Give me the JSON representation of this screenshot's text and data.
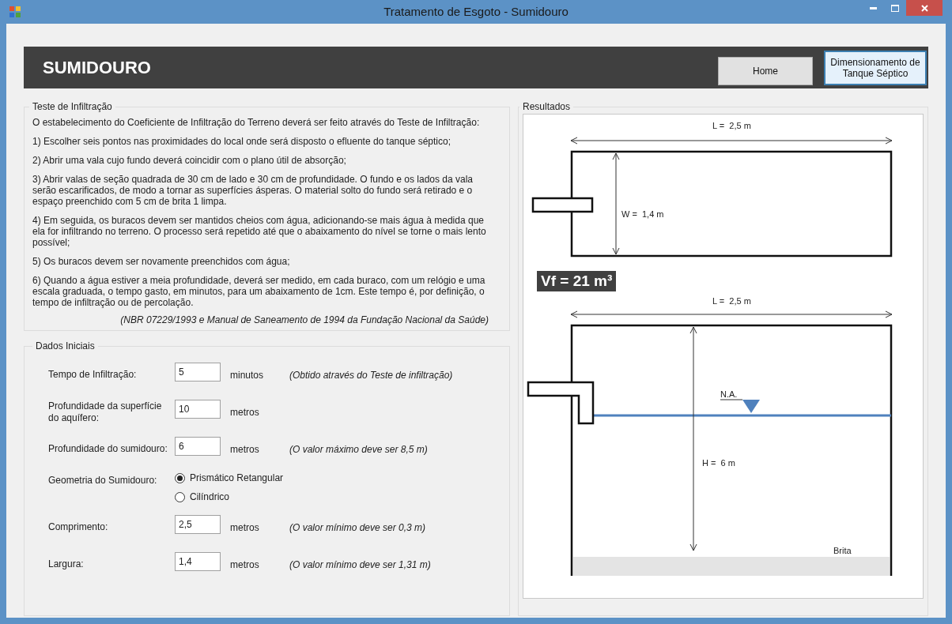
{
  "window": {
    "title": "Tratamento de Esgoto - Sumidouro"
  },
  "header": {
    "title": "SUMIDOURO",
    "buttons": [
      {
        "label": "Home",
        "selected": false
      },
      {
        "label": "Dimensionamento de Tanque Séptico",
        "selected": true
      }
    ]
  },
  "infiltration_test": {
    "title": "Teste de Infiltração",
    "paragraphs": [
      "O estabelecimento do Coeficiente de Infiltração do Terreno deverá ser feito através do Teste de Infiltração:",
      "1) Escolher seis pontos nas proximidades do local onde será disposto o efluente do tanque séptico;",
      "2) Abrir uma vala cujo fundo deverá coincidir com o plano útil de absorção;",
      "3) Abrir valas de seção quadrada de 30 cm de lado e 30 cm de profundidade. O fundo e os lados da vala serão escarificados, de modo a tornar as superfícies ásperas. O material solto do fundo será retirado e o espaço preenchido com 5 cm de brita 1 limpa.",
      "4) Em seguida, os buracos devem ser mantidos cheios com água, adicionando-se mais água à medida que ela for infiltrando no terreno. O processo será repetido até que o abaixamento do nível se torne o mais lento possível;",
      "5) Os buracos devem ser novamente preenchidos com água;",
      "6) Quando a água estiver a meia profundidade, deverá ser medido, em cada buraco, com um relógio e uma escala graduada, o tempo gasto, em minutos, para um abaixamento de 1cm. Este tempo é, por definição, o tempo de infiltração ou de percolação."
    ],
    "reference": "(NBR 07229/1993 e Manual de Saneamento de 1994 da Fundação Nacional da Saúde)"
  },
  "initial_data": {
    "title": "Dados Iniciais",
    "fields": [
      {
        "kind": "input",
        "label": "Tempo de Infiltração:",
        "value": "5",
        "unit": "minutos",
        "note": "(Obtido através do Teste de infiltração)"
      },
      {
        "kind": "input",
        "label": "Profundidade da superfície do aquífero:",
        "value": "10",
        "unit": "metros"
      },
      {
        "kind": "input",
        "label": "Profundidade do sumidouro:",
        "value": "6",
        "unit": "metros",
        "note": "(O valor máximo deve ser 8,5 m)"
      },
      {
        "kind": "radio",
        "label": "Geometria do Sumidouro:",
        "options": [
          {
            "label": "Prismático Retangular",
            "selected": true
          },
          {
            "label": "Cilíndrico",
            "selected": false
          }
        ]
      },
      {
        "kind": "input",
        "label": "Comprimento:",
        "value": "2,5",
        "unit": "metros",
        "note": "(O valor mínimo deve ser 0,3 m)"
      },
      {
        "kind": "input",
        "label": "Largura:",
        "value": "1,4",
        "unit": "metros",
        "note": "(O valor mínimo deve ser 1,31 m)"
      }
    ]
  },
  "results": {
    "title": "Resultados",
    "top_length": "L =  2,5 m",
    "width": "W =  1,4 m",
    "volume": "Vf = 21 m³",
    "side_length": "L =  2,5 m",
    "water_level": "N.A.",
    "height": "H =  6 m",
    "gravel": "Brita"
  }
}
